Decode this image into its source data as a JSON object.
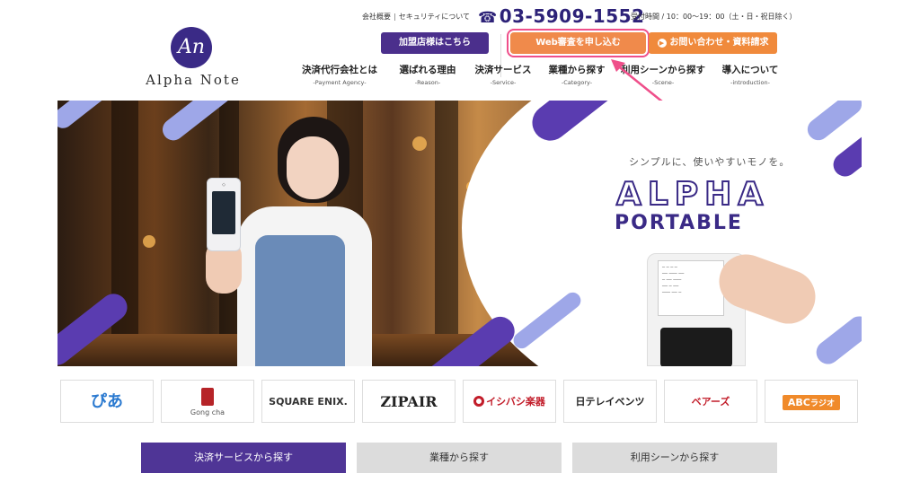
{
  "header": {
    "logo_mark": "An",
    "logo_text": "Alpha Note",
    "top_links": [
      "会社概要",
      "セキュリティについて"
    ],
    "phone": "03-5909-1552",
    "hours": "受付時間 / 10：00～19：00（土・日・祝日除く）",
    "buttons": {
      "member": "加盟店様はこちら",
      "web_review": "Web審査を申し込む",
      "contact": "お問い合わせ・資料請求"
    },
    "nav": [
      {
        "label": "決済代行会社とは",
        "sub": "-Payment Agency-"
      },
      {
        "label": "選ばれる理由",
        "sub": "-Reason-"
      },
      {
        "label": "決済サービス",
        "sub": "-Service-"
      },
      {
        "label": "業種から探す",
        "sub": "-Category-"
      },
      {
        "label": "利用シーンから探す",
        "sub": "-Scene-"
      },
      {
        "label": "導入について",
        "sub": "-introduction-"
      }
    ]
  },
  "hero": {
    "tagline": "シンプルに、使いやすいモノを。",
    "title_line1": "ALPHA",
    "title_line2": "PORTABLE",
    "accent_colors": {
      "purple": "#5a3cb0",
      "lavender": "#9ea7e8"
    }
  },
  "partners": [
    {
      "name": "ぴあ"
    },
    {
      "name": "Gong cha"
    },
    {
      "name": "SQUARE ENIX."
    },
    {
      "name": "ZIPAIR"
    },
    {
      "name": "イシバシ楽器"
    },
    {
      "name": "日テレイベンツ"
    },
    {
      "name": "ベアーズ"
    },
    {
      "name": "ABC",
      "suffix": "ラジオ"
    }
  ],
  "tabs": [
    {
      "label": "決済サービスから探す",
      "active": true
    },
    {
      "label": "業種から探す",
      "active": false
    },
    {
      "label": "利用シーンから探す",
      "active": false
    }
  ],
  "annotation": {
    "highlight_color": "#ef4f8a"
  }
}
